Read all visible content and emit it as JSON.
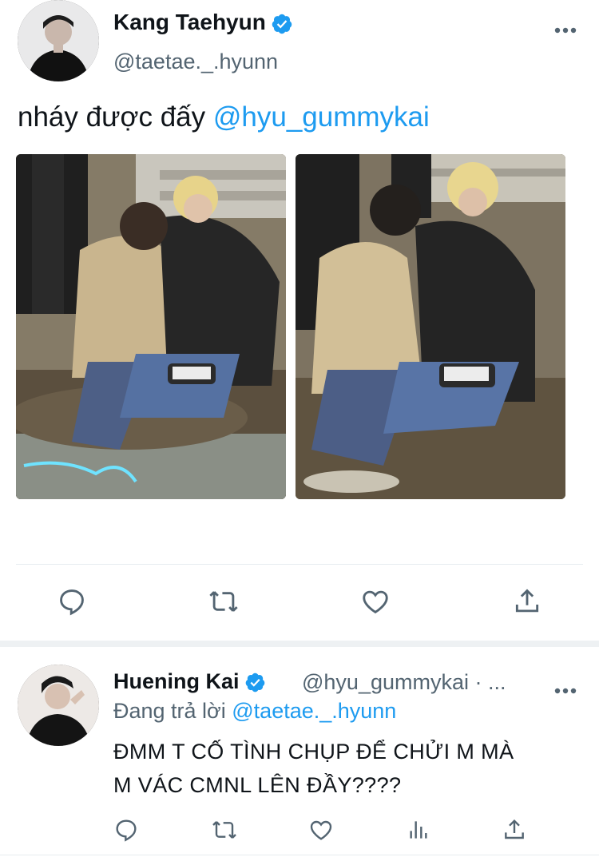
{
  "tweet": {
    "display_name": "Kang Taehyun",
    "handle": "@taetae._.hyunn",
    "text_prefix": "nháy được đấy ",
    "mention": "@hyu_gummykai",
    "more_icon": "more-dots-icon",
    "verified_color": "#1d9bf0",
    "actions": [
      "reply-icon",
      "retweet-icon",
      "like-icon",
      "share-icon"
    ]
  },
  "reply": {
    "display_name": "Huening Kai",
    "handle_meta": "@hyu_gummykai · ...",
    "replying_prefix": "Đang trả lời ",
    "replying_to": "@taetae._.hyunn",
    "line1": "ĐMM T CỐ TÌNH CHỤP ĐỂ CHỬI M MÀ",
    "line2": "M VÁC CMNL LÊN ĐẦY????",
    "actions": [
      "reply-icon",
      "retweet-icon",
      "like-icon",
      "analytics-icon",
      "share-icon"
    ]
  },
  "colors": {
    "accent": "#1d9bf0",
    "secondary_text": "#536471",
    "primary_text": "#0f1419"
  }
}
